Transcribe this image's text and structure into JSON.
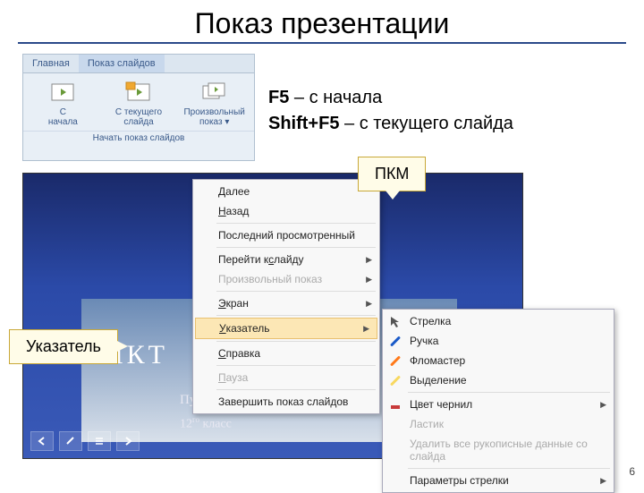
{
  "title": "Показ презентации",
  "ribbon": {
    "tabs": [
      "Главная",
      "Показ слайдов"
    ],
    "buttons": [
      {
        "line1": "С",
        "line2": "начала"
      },
      {
        "line1": "С текущего",
        "line2": "слайда"
      },
      {
        "line1": "Произвольный",
        "line2": "показ ▾"
      }
    ],
    "group_caption": "Начать показ слайдов"
  },
  "shortcuts": {
    "f5_label": "F5",
    "f5_text": " – с начала",
    "shiftf5_label": "Shift+F5",
    "shiftf5_text": " – с текущего слайда"
  },
  "callouts": {
    "pkm": "ПКМ",
    "pointer": "Указатель"
  },
  "slide": {
    "title_fragment": "НКТ",
    "subtitle1": "Пупкин Василий",
    "subtitle2a": "12",
    "subtitle2b": "го",
    "subtitle2c": " класс"
  },
  "context_menu": [
    {
      "label": "Далее",
      "u": "Д",
      "rest": "алее"
    },
    {
      "label": "Назад",
      "u": "Н",
      "rest": "азад"
    },
    {
      "sep": true
    },
    {
      "label": "Последний просмотренный"
    },
    {
      "sep": true
    },
    {
      "label": "Перейти к слайду",
      "u": "с",
      "pre": "Перейти к ",
      "rest": "лайду",
      "arrow": true
    },
    {
      "label": "Произвольный показ",
      "disabled": true,
      "arrow": true
    },
    {
      "sep": true
    },
    {
      "label": "Экран",
      "u": "Э",
      "rest": "кран",
      "arrow": true
    },
    {
      "sep": true
    },
    {
      "label": "Указатель",
      "u": "У",
      "rest": "казатель",
      "arrow": true,
      "hot": true
    },
    {
      "sep": true
    },
    {
      "label": "Справка",
      "u": "С",
      "rest": "правка"
    },
    {
      "sep": true
    },
    {
      "label": "Пауза",
      "u": "П",
      "rest": "ауза",
      "disabled": true
    },
    {
      "sep": true
    },
    {
      "label": "Завершить показ слайдов"
    }
  ],
  "pointer_menu": [
    {
      "label": "Стрелка",
      "icon": "arrow",
      "color": "#555"
    },
    {
      "label": "Ручка",
      "icon": "pen",
      "color": "#1a5ac8"
    },
    {
      "label": "Фломастер",
      "icon": "pen",
      "color": "#ff7a1a"
    },
    {
      "label": "Выделение",
      "icon": "pen",
      "color": "#f8d860"
    },
    {
      "sep": true
    },
    {
      "label": "Цвет чернил",
      "icon": "color",
      "arrow": true
    },
    {
      "label": "Ластик",
      "disabled": true
    },
    {
      "label": "Удалить все рукописные данные со слайда",
      "disabled": true
    },
    {
      "sep": true
    },
    {
      "label": "Параметры стрелки",
      "arrow": true
    }
  ],
  "page_number": "6"
}
